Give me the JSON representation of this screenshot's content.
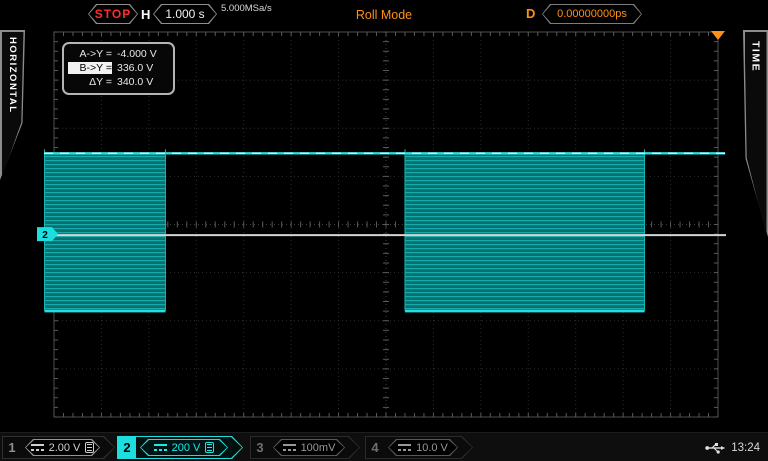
{
  "top_bar": {
    "stop_label": "STOP",
    "h_label": "H",
    "timebase": "1.000 s",
    "sample_rate": "5.000MSa/s",
    "mode": "Roll Mode",
    "delay_label": "D",
    "delay_value": "0.00000000ps"
  },
  "side_tabs": {
    "left": "HORIZONTAL",
    "right": "TIME"
  },
  "cursor_box": {
    "rows": [
      {
        "label": "A->Y =",
        "value": "-4.000 V",
        "highlighted": false
      },
      {
        "label": "B->Y =",
        "value": "336.0 V",
        "highlighted": true
      },
      {
        "label": "ΔY =",
        "value": "340.0 V",
        "highlighted": false
      }
    ]
  },
  "channels": [
    {
      "number": "1",
      "coupling": "dc",
      "scale": "2.00 V",
      "bw_limit": true,
      "active": false
    },
    {
      "number": "2",
      "coupling": "dc",
      "scale": "200 V",
      "bw_limit": true,
      "active": true
    },
    {
      "number": "3",
      "coupling": "dc",
      "scale": "100mV",
      "bw_limit": false,
      "active": false
    },
    {
      "number": "4",
      "coupling": "dc",
      "scale": "10.0 V",
      "bw_limit": false,
      "active": false
    }
  ],
  "status": {
    "time": "13:24"
  },
  "colors": {
    "accent_cyan": "#1cdede",
    "accent_orange": "#ff9015",
    "stop_red": "#ff2d2d",
    "trace_fill": "#0a7171",
    "trace_stripe": "#17a9a9",
    "rail_cyan": "#25dede",
    "cursor_b": "#d8ffff",
    "cursor_a": "#d4d4d4",
    "grid_line": "#2b2f2f",
    "grid_center": "#3c4242",
    "grid_edge": "#4e4e4e",
    "grid_tick": "#5a5a5a"
  },
  "chart_data": {
    "type": "line",
    "subtype": "oscilloscope-roll-trace",
    "title": "Roll Mode acquisition, stopped",
    "h_divisions": 14,
    "v_divisions": 8,
    "timebase_per_div": "1.000 s",
    "sample_rate": "5.000MSa/s",
    "channel": {
      "label": "2",
      "volts_per_div": 200,
      "zero_offset_div_below_center": 0.2
    },
    "cursors": {
      "a_volts": -4.0,
      "b_volts": 336.0,
      "delta_volts": 340.0,
      "delay": "0.00000000ps"
    },
    "trigger_position_div": 14,
    "segments": [
      {
        "type": "burst",
        "t0_div": -0.2,
        "t1_div": 2.35,
        "v_high": 336,
        "v_low": -320
      },
      {
        "type": "flat",
        "t0_div": 2.35,
        "t1_div": 7.4,
        "v": 336
      },
      {
        "type": "burst",
        "t0_div": 7.4,
        "t1_div": 12.45,
        "v_high": 336,
        "v_low": -320
      },
      {
        "type": "flat",
        "t0_div": 12.45,
        "t1_div": 14.15,
        "v": 336
      }
    ]
  }
}
